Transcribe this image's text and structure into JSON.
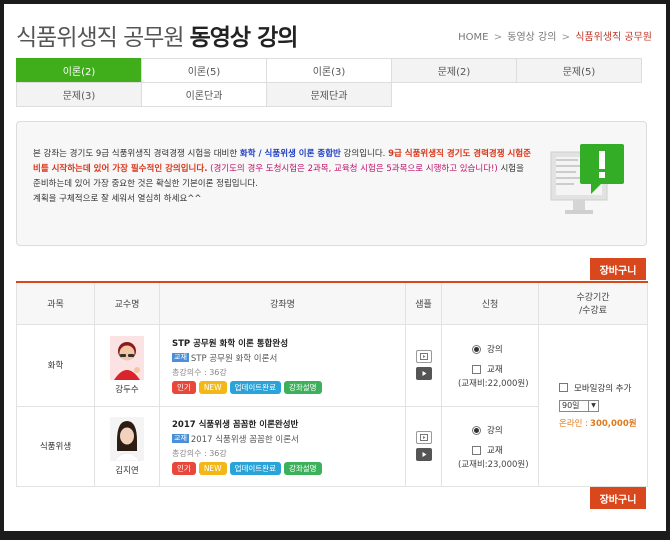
{
  "header": {
    "title_light": "식품위생직 공무원",
    "title_bold": "동영상 강의",
    "breadcrumb": {
      "home": "HOME",
      "sep": ">",
      "level1": "동영상 강의",
      "current": "식품위생직 공무원"
    }
  },
  "tabs": {
    "row1": [
      "이론(2)",
      "이론(5)",
      "이론(3)",
      "문제(2)",
      "문제(5)"
    ],
    "row2": [
      "문제(3)",
      "이론단과",
      "문제단과"
    ]
  },
  "intro": {
    "p1": "본 강좌는 경기도 9급 식품위생직 경력경쟁 시험을 대비한 ",
    "p1_blue": "화학 / 식품위생 이론 종합반",
    "p1b": " 강의입니다. ",
    "p1_red": "9급 식품위생직 경기도 경력경쟁 시험준비를 시작하는데 있어 가장 필수적인 강의입니다.",
    "p1_pink": " (경기도의 경우 도청시험은 2과목, 교육청 시험은 5과목으로 시행하고 있습니다!)",
    "p1c": " 시험을 준비하는데 있어 가장 중요한 것은 확실한 기본이론 정립입니다.",
    "p2": "계획을 구체적으로 잘 세워서 열심히 하세요^^"
  },
  "cart_label": "장바구니",
  "table": {
    "headers": {
      "subject": "과목",
      "professor": "교수명",
      "lecture": "강좌명",
      "sample": "샘플",
      "apply": "신청",
      "period_1": "수강기간",
      "period_2": "/수강료"
    },
    "rows": [
      {
        "subject": "화학",
        "professor": "강두수",
        "title": "STP 공무원 화학 이론 통합완성",
        "book_tag": "교재",
        "book": "STP 공무원 화학 이론서",
        "count": "총강의수 : 36강",
        "badges": [
          "인기",
          "NEW",
          "업데이트완료",
          "강좌설명"
        ],
        "apply_lecture": "강의",
        "apply_book": "교재",
        "book_price": "(교재비:22,000원)"
      },
      {
        "subject": "식품위생",
        "professor": "김지연",
        "title": "2017 식품위생 꼼꼼한 이론완성반",
        "book_tag": "교재",
        "book": "2017 식품위생 꼼꼼한 이론서",
        "count": "총강의수 : 36강",
        "badges": [
          "인기",
          "NEW",
          "업데이트완료",
          "강좌설명"
        ],
        "apply_lecture": "강의",
        "apply_book": "교재",
        "book_price": "(교재비:23,000원)"
      }
    ],
    "period": {
      "mobile_label": "모바일강의 추가",
      "select_value": "90일",
      "online_label": "온라인 :",
      "online_price": "300,000원"
    }
  },
  "colors": {
    "active_tab": "#3fae1a",
    "cart": "#d9481c",
    "badge_red": "#e8473b",
    "badge_yellow": "#f3b817",
    "badge_blue": "#2aa3d8",
    "badge_green": "#3cb05a"
  },
  "icons": [
    "notice-monitor-icon",
    "play-sample-icon",
    "play-dark-icon",
    "dropdown-arrow-icon"
  ]
}
